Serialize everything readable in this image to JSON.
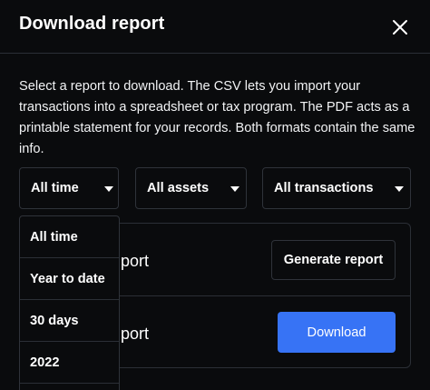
{
  "dialog": {
    "title": "Download report",
    "close_icon": "close-icon",
    "description": "Select a report to download. The CSV lets you import your transactions into a spreadsheet or tax program. The PDF acts as a printable statement for your records. Both formats contain the same info."
  },
  "filters": {
    "time": {
      "value": "All time",
      "icon": "chevron-down-icon"
    },
    "assets": {
      "value": "All assets",
      "icon": "chevron-down-icon"
    },
    "transactions": {
      "value": "All transactions",
      "icon": "chevron-down-icon"
    }
  },
  "time_dropdown": {
    "options": [
      "All time",
      "Year to date",
      "30 days",
      "2022"
    ]
  },
  "reports": [
    {
      "name_visible": "port",
      "action_label": "Generate report"
    },
    {
      "name_visible": "port",
      "action_label": "Download"
    }
  ],
  "colors": {
    "background": "#0a0b0d",
    "border": "#2f333a",
    "primary_button": "#3773f5",
    "text": "#ffffff"
  }
}
